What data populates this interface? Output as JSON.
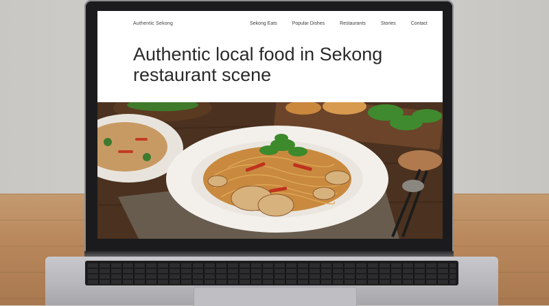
{
  "site": {
    "brand": "Authentic Sekong",
    "nav": [
      "Sekong Eats",
      "Popular Dishes",
      "Restaurants",
      "Stories",
      "Contact"
    ],
    "hero_title": "Authentic local food in Sekong restaurant scene"
  },
  "colors": {
    "wall": "#cfcdc9",
    "table": "#b8875b",
    "laptop_frame": "#1b1b1d",
    "laptop_body": "#bdbdc1",
    "screen_bg": "#ffffff",
    "text": "#2a2a2a"
  },
  "photo": {
    "subject": "noodle-dish-photo"
  }
}
